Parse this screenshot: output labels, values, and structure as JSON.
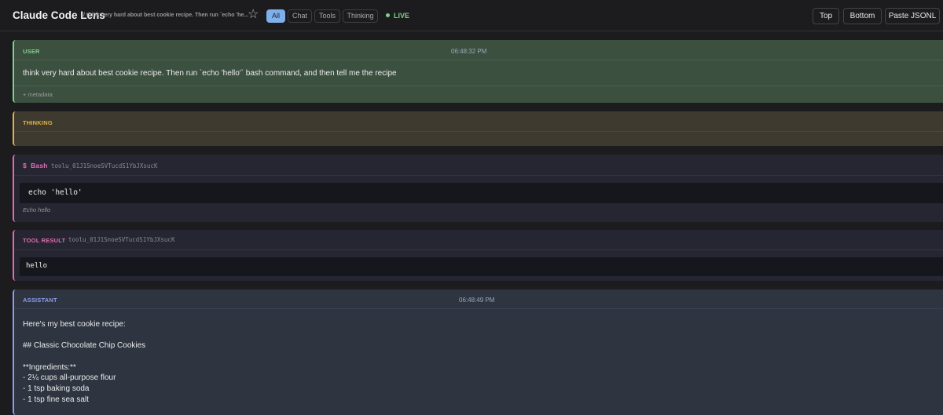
{
  "header": {
    "title": "Claude Code Lens",
    "subtitle": "/ think very hard about best cookie recipe. Then run `echo 'he...",
    "filters": [
      "All",
      "Chat",
      "Tools",
      "Thinking"
    ],
    "live": "LIVE",
    "buttons": {
      "top": "Top",
      "bottom": "Bottom",
      "paste": "Paste JSONL"
    }
  },
  "messages": {
    "user": {
      "role": "USER",
      "time": "06:48:32 PM",
      "text": "think very hard about best cookie recipe. Then run `echo 'hello'` bash command, and then tell me the recipe",
      "meta": "+ metadata"
    },
    "thinking": {
      "role": "THINKING"
    },
    "bash": {
      "prefix": "$",
      "tool": "Bash",
      "id": "toolu_01J1SnoeSVTucdS1YbJXsucK",
      "command": "echo 'hello'",
      "description": "Echo hello"
    },
    "tool_result": {
      "role": "TOOL RESULT",
      "id": "toolu_01J1SnoeSVTucdS1YbJXsucK",
      "output": "hello"
    },
    "assistant": {
      "role": "ASSISTANT",
      "time": "06:48:49 PM",
      "lines": [
        "Here's my best cookie recipe:",
        "",
        "## Classic Chocolate Chip Cookies",
        "",
        "**Ingredients:**",
        "- 2¼ cups all-purpose flour",
        "- 1 tsp baking soda",
        "- 1 tsp fine sea salt"
      ]
    }
  },
  "colors": {
    "user_accent": "#7dd389",
    "thinking_accent": "#e0b24a",
    "bash_accent": "#e06bb0",
    "assistant_accent": "#8e9cf0"
  }
}
